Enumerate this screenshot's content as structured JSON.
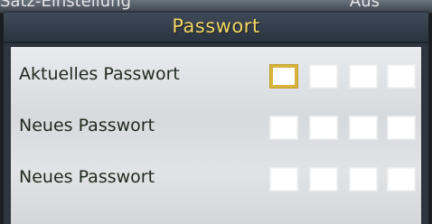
{
  "background_menu": {
    "left_text": "Satz-Einstellung",
    "right_text": "Aus"
  },
  "dialog": {
    "title": "Passwort",
    "rows": [
      {
        "label": "Aktuelles Passwort",
        "digits": [
          "",
          "",
          "",
          ""
        ],
        "focused_digit": 1
      },
      {
        "label": "Neues Passwort",
        "digits": [
          "",
          "",
          "",
          ""
        ]
      },
      {
        "label": "Neues Passwort",
        "digits": [
          "",
          "",
          "",
          ""
        ]
      }
    ]
  },
  "colors": {
    "title_text": "#f1d766",
    "focus_border": "#d8b43f"
  }
}
